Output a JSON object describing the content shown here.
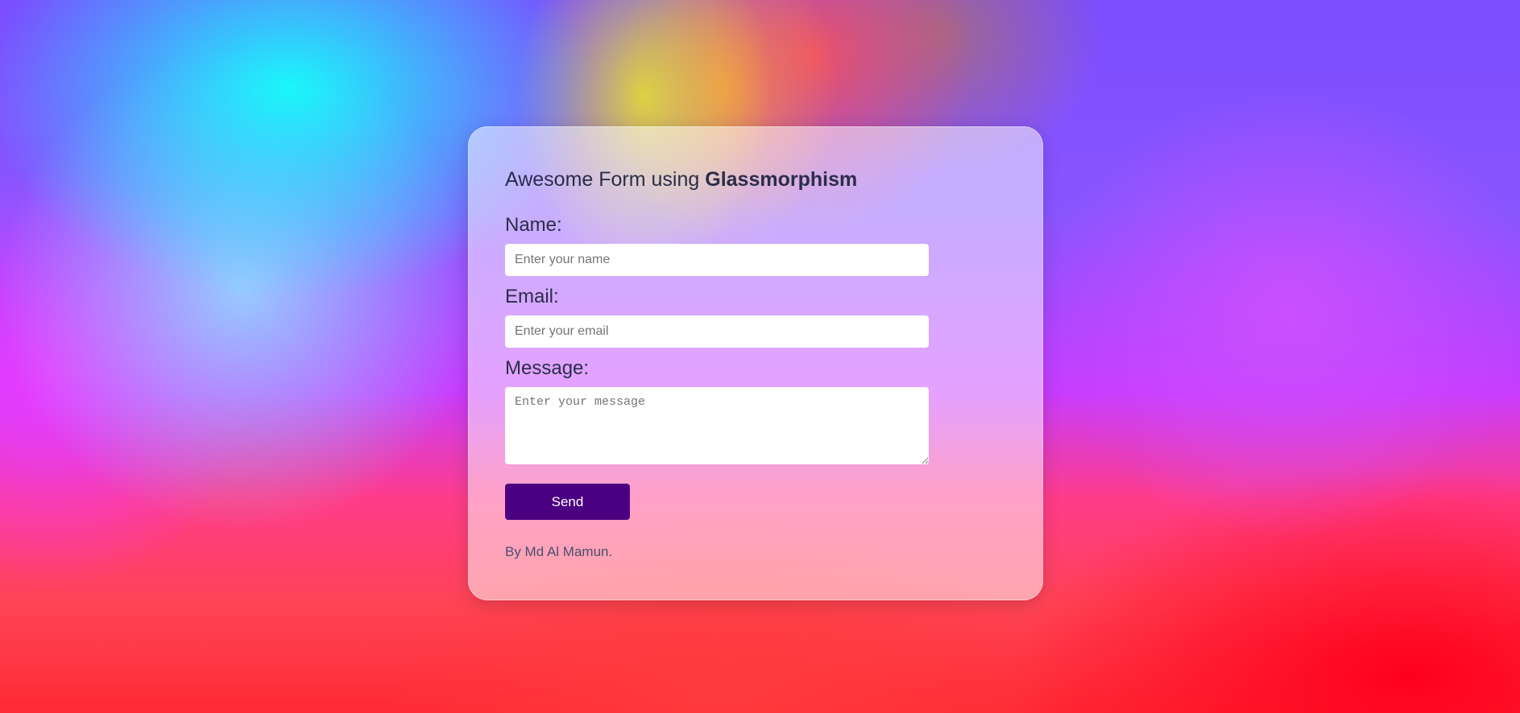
{
  "form": {
    "title_prefix": "Awesome Form using ",
    "title_emphasis": "Glassmorphism",
    "name_label": "Name:",
    "name_placeholder": "Enter your name",
    "email_label": "Email:",
    "email_placeholder": "Enter your email",
    "message_label": "Message:",
    "message_placeholder": "Enter your message",
    "send_label": "Send",
    "credit": "By Md Al Mamun."
  },
  "colors": {
    "button": "#4b0082",
    "text": "#2b2d4a"
  }
}
